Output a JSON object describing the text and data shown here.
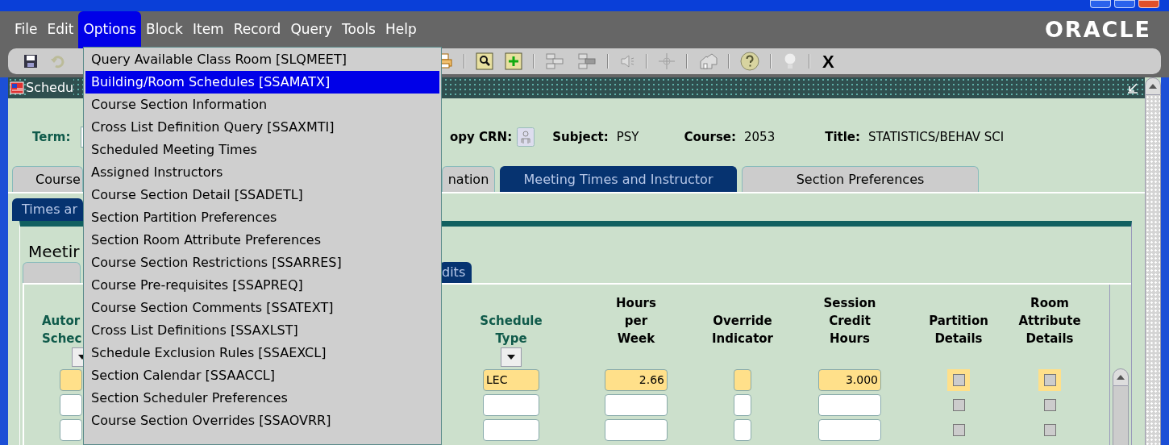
{
  "menu_bar": {
    "items": [
      {
        "label": "File",
        "selected": false
      },
      {
        "label": "Edit",
        "selected": false
      },
      {
        "label": "Options",
        "selected": true
      },
      {
        "label": "Block",
        "selected": false
      },
      {
        "label": "Item",
        "selected": false
      },
      {
        "label": "Record",
        "selected": false
      },
      {
        "label": "Query",
        "selected": false
      },
      {
        "label": "Tools",
        "selected": false
      },
      {
        "label": "Help",
        "selected": false
      }
    ],
    "brand": "ORACLE"
  },
  "toolbar": {
    "close_label": "X"
  },
  "form_window": {
    "title": "Schedu"
  },
  "header": {
    "term_label": "Term:",
    "copy_crn_label": "opy CRN:",
    "fields": [
      {
        "label": "Subject:",
        "value": "PSY"
      },
      {
        "label": "Course:",
        "value": "2053"
      },
      {
        "label": "Title:",
        "value": "STATISTICS/BEHAV SCI"
      }
    ]
  },
  "tabs": [
    {
      "label": "Course",
      "selected": false
    },
    {
      "label": "nation",
      "selected": false
    },
    {
      "label": "Meeting Times and Instructor",
      "selected": true
    },
    {
      "label": "Section Preferences",
      "selected": false
    }
  ],
  "subtabs": [
    {
      "label": "Times ar",
      "selected": true
    }
  ],
  "section": {
    "title": "Meetir",
    "tabs": [
      {
        "selected": false
      },
      {
        "label": "dits",
        "selected": true
      }
    ]
  },
  "columns": [
    {
      "label": "Autor\nSchec",
      "required": true,
      "dropdown": true,
      "kind": "text"
    },
    {
      "label": "Schedule\nType",
      "required": true,
      "dropdown": true,
      "kind": "text"
    },
    {
      "label": "Hours\nper\nWeek",
      "required": false,
      "dropdown": false,
      "kind": "number"
    },
    {
      "label": "Override\nIndicator",
      "required": false,
      "dropdown": false,
      "kind": "flag"
    },
    {
      "label": "Session\nCredit\nHours",
      "required": false,
      "dropdown": false,
      "kind": "number"
    },
    {
      "label": "Partition\nDetails",
      "required": false,
      "dropdown": false,
      "kind": "check"
    },
    {
      "label": "Room\nAttribute\nDetails",
      "required": false,
      "dropdown": false,
      "kind": "check"
    }
  ],
  "rows": [
    {
      "current": true,
      "cells": [
        {},
        {
          "value": "LEC"
        },
        {
          "value": "2.66"
        },
        {},
        {
          "value": "3.000"
        },
        {
          "checked": false
        },
        {
          "checked": false
        }
      ]
    },
    {
      "current": false,
      "cells": [
        {},
        {},
        {},
        {},
        {},
        {
          "checked": false
        },
        {
          "checked": false
        }
      ]
    },
    {
      "current": false,
      "cells": [
        {},
        {},
        {},
        {},
        {},
        {
          "checked": false
        },
        {
          "checked": false
        }
      ]
    }
  ],
  "options_menu": {
    "items": [
      {
        "label": "Query Available Class Room [SLQMEET]",
        "selected": false
      },
      {
        "label": "Building/Room Schedules [SSAMATX]",
        "selected": true
      },
      {
        "label": "Course Section Information",
        "selected": false
      },
      {
        "label": "Cross List Definition Query [SSAXMTI]",
        "selected": false
      },
      {
        "label": "Scheduled Meeting Times",
        "selected": false
      },
      {
        "label": "Assigned Instructors",
        "selected": false
      },
      {
        "label": "Course Section Detail [SSADETL]",
        "selected": false
      },
      {
        "label": "Section Partition Preferences",
        "selected": false
      },
      {
        "label": "Section Room Attribute Preferences",
        "selected": false
      },
      {
        "label": "Course Section Restrictions [SSARRES]",
        "selected": false
      },
      {
        "label": "Course Pre-requisites [SSAPREQ]",
        "selected": false
      },
      {
        "label": "Course Section Comments [SSATEXT]",
        "selected": false
      },
      {
        "label": "Cross List Definitions [SSAXLST]",
        "selected": false
      },
      {
        "label": "Schedule Exclusion Rules [SSAEXCL]",
        "selected": false
      },
      {
        "label": "Section Calendar [SSAACCL]",
        "selected": false
      },
      {
        "label": "Section Scheduler Preferences",
        "selected": false
      },
      {
        "label": "Course Section Overrides [SSAOVRR]",
        "selected": false
      }
    ]
  }
}
